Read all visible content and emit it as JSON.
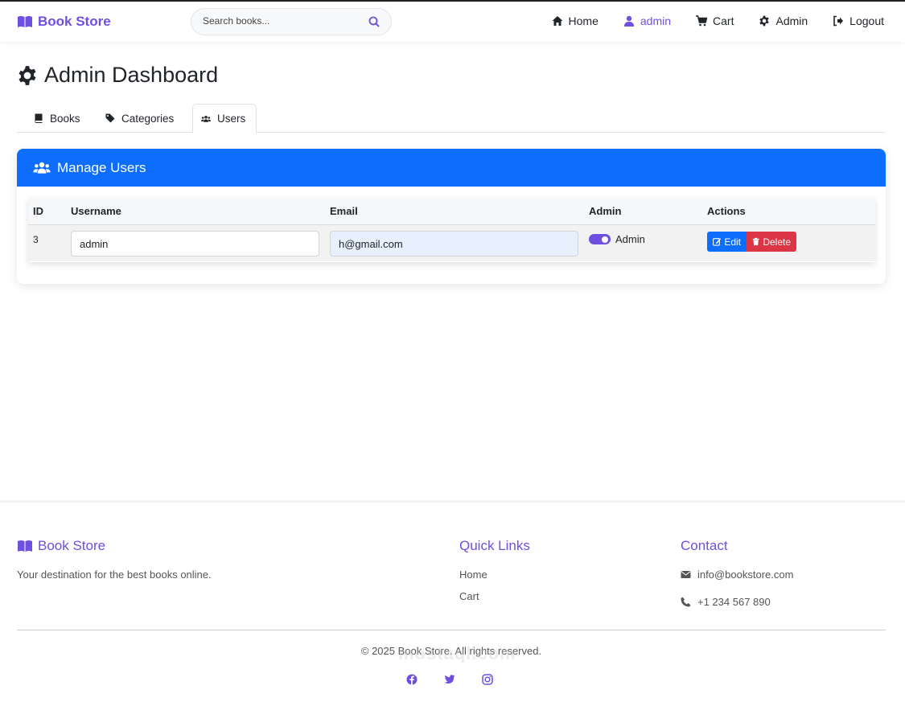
{
  "navbar": {
    "brand": "Book Store",
    "search_placeholder": "Search books...",
    "items": [
      {
        "label": "Home",
        "icon": "home-icon"
      },
      {
        "label": "admin",
        "icon": "user-icon"
      },
      {
        "label": "Cart",
        "icon": "cart-icon"
      },
      {
        "label": "Admin",
        "icon": "gear-icon"
      },
      {
        "label": "Logout",
        "icon": "logout-icon"
      }
    ]
  },
  "page": {
    "title": "Admin Dashboard",
    "tabs": [
      {
        "label": "Books",
        "icon": "book-icon"
      },
      {
        "label": "Categories",
        "icon": "tags-icon"
      },
      {
        "label": "Users",
        "icon": "users-icon"
      }
    ]
  },
  "card": {
    "title": "Manage Users",
    "columns": [
      "ID",
      "Username",
      "Email",
      "Admin",
      "Actions"
    ],
    "rows": [
      {
        "id": "3",
        "username": "admin",
        "email": "h@gmail.com",
        "admin_label": "Admin",
        "edit_label": "Edit",
        "delete_label": "Delete"
      }
    ]
  },
  "footer": {
    "brand": "Book Store",
    "tagline": "Your destination for the best books online.",
    "quick_links_title": "Quick Links",
    "quick_links": [
      "Home",
      "Cart"
    ],
    "contact_title": "Contact",
    "email": "info@bookstore.com",
    "phone": "+1 234 567 890",
    "copyright": "© 2025 Book Store. All rights reserved.",
    "socials": [
      "facebook-icon",
      "twitter-icon",
      "instagram-icon"
    ],
    "watermark": "mostaql.com"
  },
  "colors": {
    "accent": "#6f4fe0",
    "primary": "#0d6efd",
    "danger": "#dc3545"
  }
}
